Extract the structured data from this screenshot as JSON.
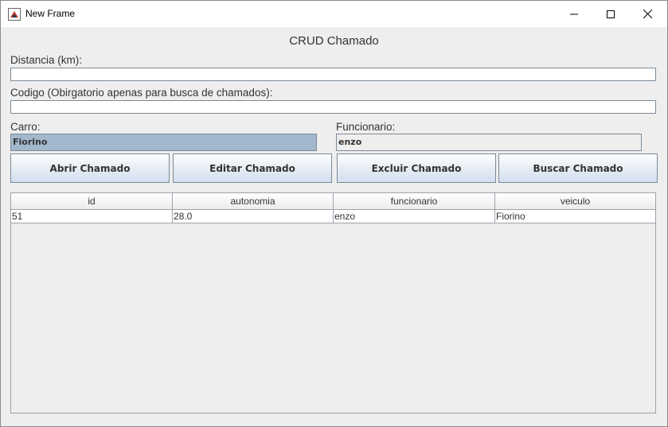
{
  "window": {
    "title": "New Frame"
  },
  "form": {
    "heading": "CRUD Chamado",
    "distancia_label": "Distancia (km):",
    "distancia_value": "",
    "codigo_label": "Codigo (Obirgatorio apenas para busca de chamados):",
    "codigo_value": "",
    "carro_label": "Carro:",
    "carro_value": "Fiorino",
    "funcionario_label": "Funcionario:",
    "funcionario_value": "enzo"
  },
  "buttons": {
    "abrir": "Abrir Chamado",
    "editar": "Editar Chamado",
    "excluir": "Excluir Chamado",
    "buscar": "Buscar Chamado"
  },
  "table": {
    "columns": [
      "id",
      "autonomia",
      "funcionario",
      "veiculo"
    ],
    "rows": [
      [
        "51",
        "28.0",
        "enzo",
        "Fiorino"
      ]
    ]
  }
}
